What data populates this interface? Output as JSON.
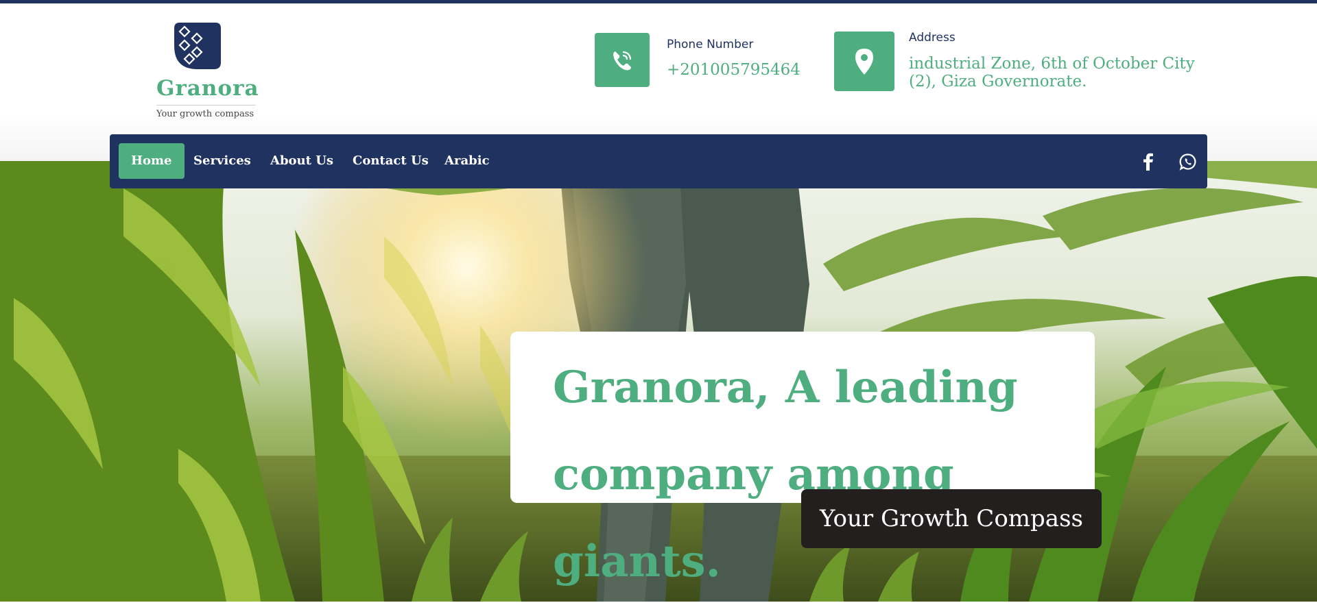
{
  "brand": {
    "name": "Granora",
    "tagline": "Your growth compass",
    "colors": {
      "primary_green": "#4fae80",
      "navy": "#1f3260",
      "dark_badge": "#231f1e"
    }
  },
  "contact": {
    "phone": {
      "label": "Phone Number",
      "value": "+201005795464",
      "icon": "phone-icon"
    },
    "address": {
      "label": "Address",
      "value": "industrial Zone, 6th of October City (2), Giza Governorate.",
      "icon": "map-pin-icon"
    }
  },
  "nav": {
    "items": [
      {
        "label": "Home",
        "active": true
      },
      {
        "label": "Services",
        "active": false
      },
      {
        "label": "About Us",
        "active": false
      },
      {
        "label": "Contact Us",
        "active": false
      },
      {
        "label": "Arabic",
        "active": false
      }
    ],
    "social": [
      {
        "name": "facebook",
        "icon": "facebook-icon"
      },
      {
        "name": "whatsapp",
        "icon": "whatsapp-icon"
      }
    ]
  },
  "hero": {
    "headline": "Granora, A leading company among giants.",
    "badge": "Your Growth Compass",
    "background": "corn-field-photo"
  }
}
